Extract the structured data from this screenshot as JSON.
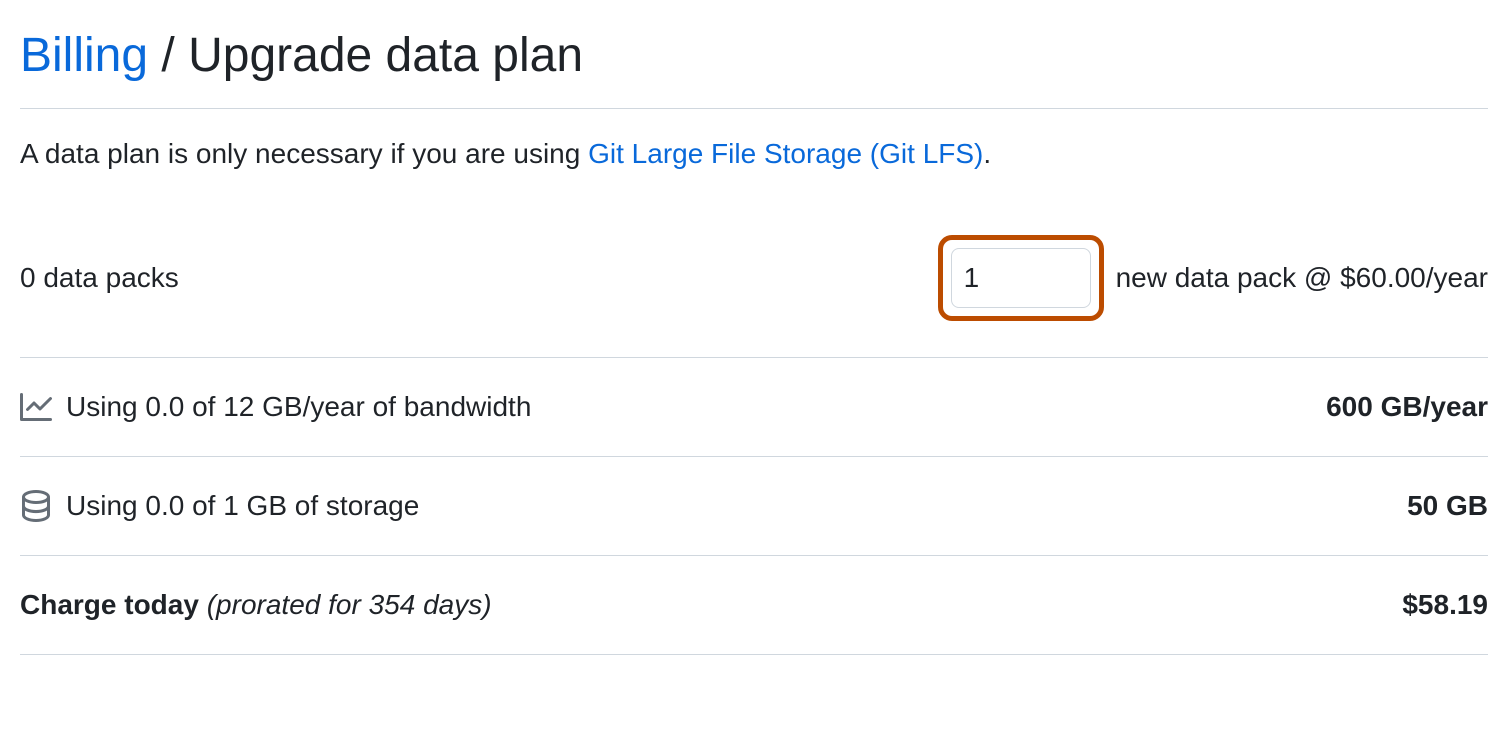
{
  "header": {
    "billing_link": "Billing",
    "separator": " / ",
    "page_title": "Upgrade data plan"
  },
  "intro": {
    "prefix": "A data plan is only necessary if you are using ",
    "link_text": "Git Large File Storage (Git LFS)",
    "suffix": "."
  },
  "packs": {
    "current_label": "0 data packs",
    "input_value": "1",
    "rate_label": "new data pack @ $60.00/year"
  },
  "bandwidth": {
    "usage_text": "Using 0.0 of 12 GB/year of bandwidth",
    "value": "600 GB/year"
  },
  "storage": {
    "usage_text": "Using 0.0 of 1 GB of storage",
    "value": "50 GB"
  },
  "charge": {
    "label": "Charge today",
    "prorated": "(prorated for 354 days)",
    "amount": "$58.19"
  }
}
